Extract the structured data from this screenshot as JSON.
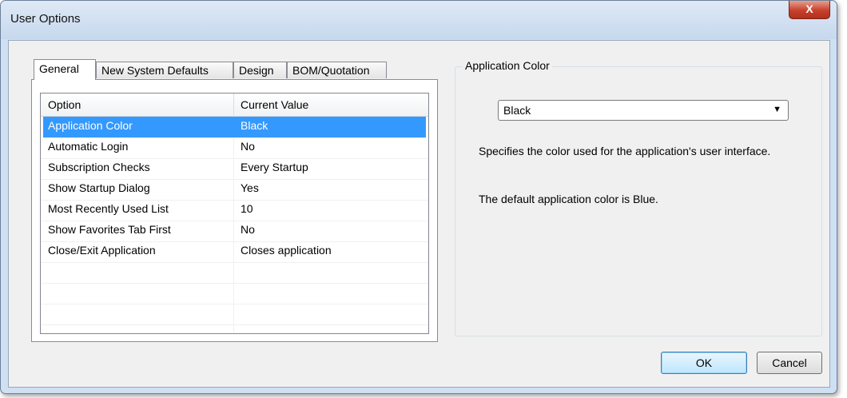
{
  "window": {
    "title": "User Options",
    "close_label": "X"
  },
  "tabs": [
    {
      "label": "General"
    },
    {
      "label": "New System Defaults"
    },
    {
      "label": "Design"
    },
    {
      "label": "BOM/Quotation"
    }
  ],
  "grid": {
    "headers": [
      "Option",
      "Current Value"
    ],
    "rows": [
      {
        "option": "Application Color",
        "value": "Black"
      },
      {
        "option": "Automatic Login",
        "value": "No"
      },
      {
        "option": "Subscription Checks",
        "value": "Every Startup"
      },
      {
        "option": "Show Startup Dialog",
        "value": "Yes"
      },
      {
        "option": "Most Recently Used List",
        "value": "10"
      },
      {
        "option": "Show Favorites Tab First",
        "value": "No"
      },
      {
        "option": "Close/Exit Application",
        "value": "Closes application"
      }
    ]
  },
  "detail": {
    "group_label": "Application Color",
    "combo_value": "Black",
    "description": "Specifies the color used for the application's user interface.",
    "default_note": "The default application color is Blue."
  },
  "buttons": {
    "ok": "OK",
    "cancel": "Cancel"
  }
}
